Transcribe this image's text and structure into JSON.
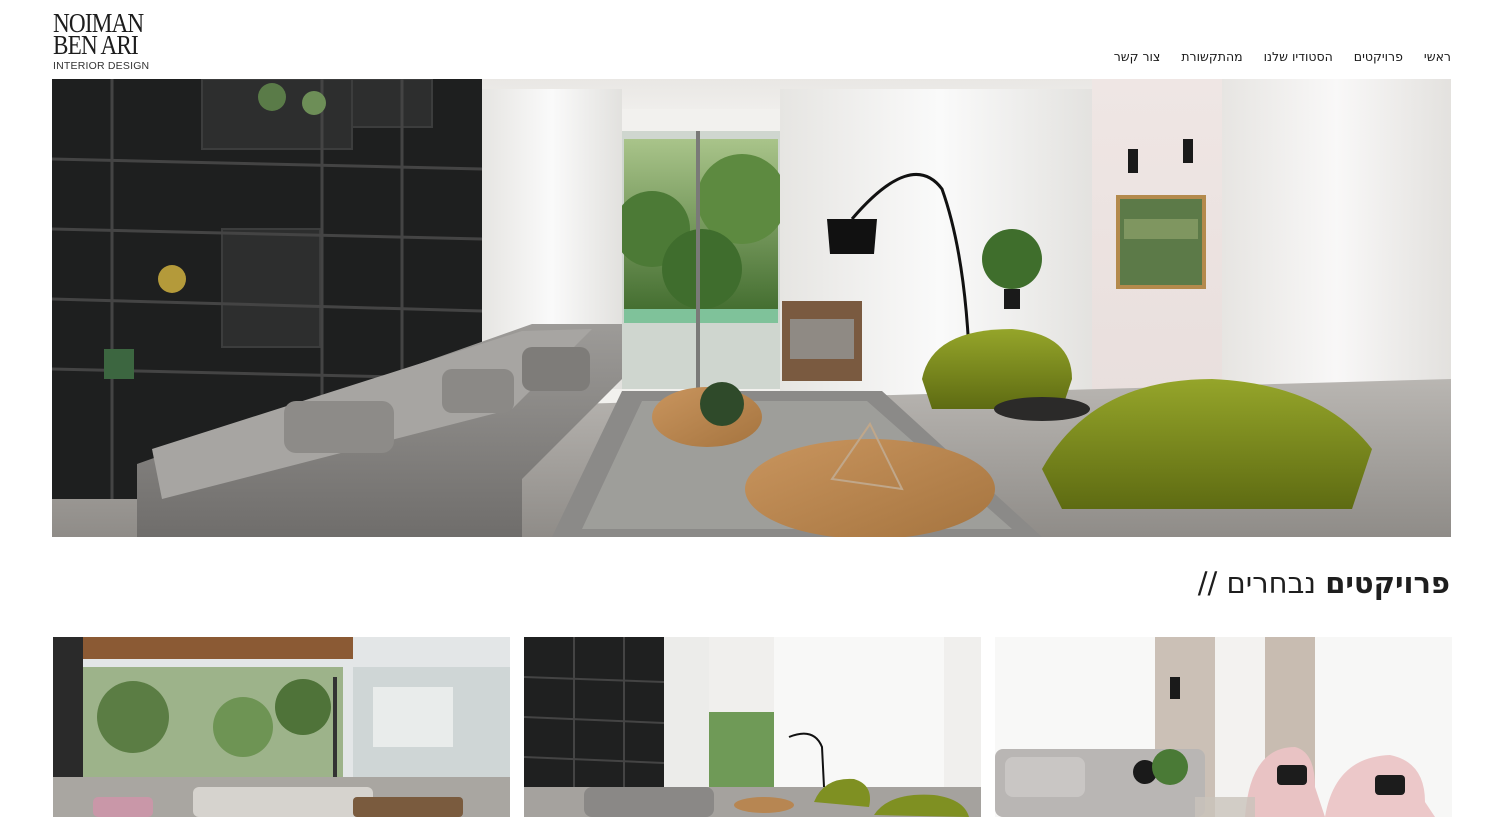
{
  "logo": {
    "line1": "NOIMAN",
    "line2": "BEN ARI",
    "tagline": "INTERIOR DESIGN"
  },
  "nav": {
    "items": [
      {
        "label": "ראשי"
      },
      {
        "label": "פרויקטים"
      },
      {
        "label": "הסטודיו שלנו"
      },
      {
        "label": "מהתקשורת"
      },
      {
        "label": "צור קשר"
      }
    ]
  },
  "hero": {
    "image": "living-room-photo"
  },
  "featured": {
    "title_bold": "פרויקטים",
    "title_light": "נבחרים //",
    "projects": [
      {
        "image": "indoor-outdoor-living-photo"
      },
      {
        "image": "living-room-wide-photo"
      },
      {
        "image": "pink-armchairs-living-photo"
      }
    ]
  },
  "colors": {
    "accent_green": "#7a8a1e",
    "sofa_gray": "#8c8a88",
    "wood": "#b78652",
    "shelves": "#1e1f1f"
  }
}
